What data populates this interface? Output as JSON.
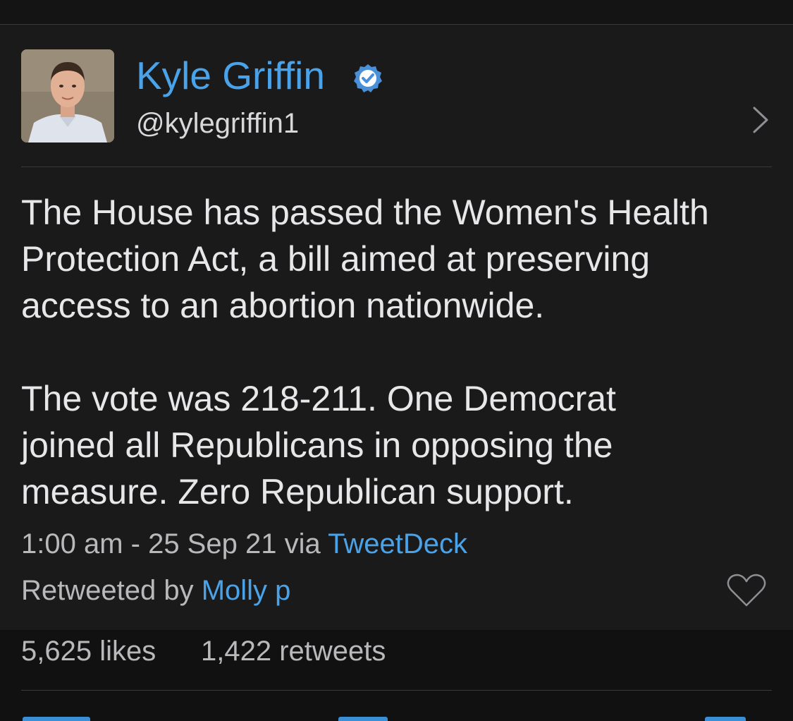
{
  "author": {
    "display_name": "Kyle Griffin",
    "handle": "@kylegriffin1",
    "verified": true,
    "verified_icon": "verified-badge-icon",
    "avatar_icon": "profile-photo"
  },
  "tweet": {
    "text": "The House has passed the Women's Health\nProtection Act, a bill aimed at preserving\naccess to an abortion nationwide.\n\nThe vote was 218-211. One Democrat\njoined all Republicans in opposing the\nmeasure. Zero Republican support.",
    "timestamp": "1:00 am - 25 Sep 21",
    "via_label": "via",
    "client": "TweetDeck"
  },
  "retweet": {
    "prefix": "Retweeted by",
    "user": "Molly p"
  },
  "stats": {
    "likes": "5,625 likes",
    "retweets": "1,422 retweets"
  },
  "icons": {
    "chevron": "chevron-right-icon",
    "like": "heart-icon"
  },
  "colors": {
    "background": "#1a1a1b",
    "link": "#4aa3e8",
    "text": "#e7e7e9",
    "secondary_text": "#b9b9bc",
    "verified": "#4a90d9"
  }
}
